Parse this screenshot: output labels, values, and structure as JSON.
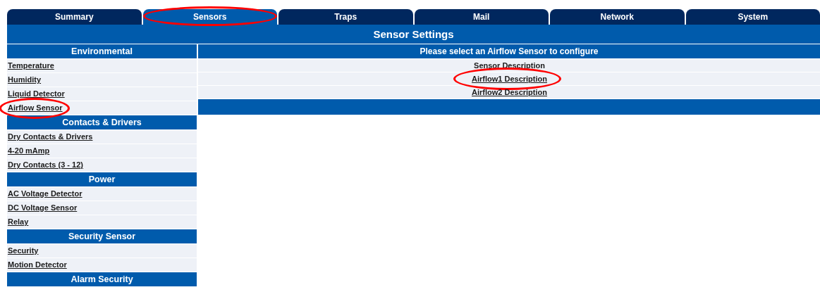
{
  "tabs": [
    {
      "label": "Summary",
      "selected": false,
      "circled": false
    },
    {
      "label": "Sensors",
      "selected": true,
      "circled": true
    },
    {
      "label": "Traps",
      "selected": false,
      "circled": false
    },
    {
      "label": "Mail",
      "selected": false,
      "circled": false
    },
    {
      "label": "Network",
      "selected": false,
      "circled": false
    },
    {
      "label": "System",
      "selected": false,
      "circled": false
    }
  ],
  "page_title": "Sensor Settings",
  "sidebar": {
    "groups": [
      {
        "title": "Environmental",
        "items": [
          {
            "label": "Temperature",
            "circled": false
          },
          {
            "label": "Humidity",
            "circled": false
          },
          {
            "label": "Liquid Detector",
            "circled": false
          },
          {
            "label": "Airflow Sensor",
            "circled": true
          }
        ]
      },
      {
        "title": "Contacts & Drivers",
        "items": [
          {
            "label": "Dry Contacts & Drivers",
            "circled": false
          },
          {
            "label": "4-20 mAmp",
            "circled": false
          },
          {
            "label": "Dry Contacts (3 - 12)",
            "circled": false
          }
        ]
      },
      {
        "title": "Power",
        "items": [
          {
            "label": "AC Voltage Detector",
            "circled": false
          },
          {
            "label": "DC Voltage Sensor",
            "circled": false
          },
          {
            "label": "Relay",
            "circled": false
          }
        ]
      },
      {
        "title": "Security Sensor",
        "items": [
          {
            "label": "Security",
            "circled": false
          },
          {
            "label": "Motion Detector",
            "circled": false
          }
        ]
      },
      {
        "title": "Alarm Security"
      }
    ]
  },
  "panel": {
    "title": "Please select an Airflow Sensor to configure",
    "column_heading": "Sensor Description",
    "rows": [
      {
        "label": "Airflow1 Description",
        "circled": true
      },
      {
        "label": "Airflow2 Description",
        "circled": false
      }
    ]
  }
}
